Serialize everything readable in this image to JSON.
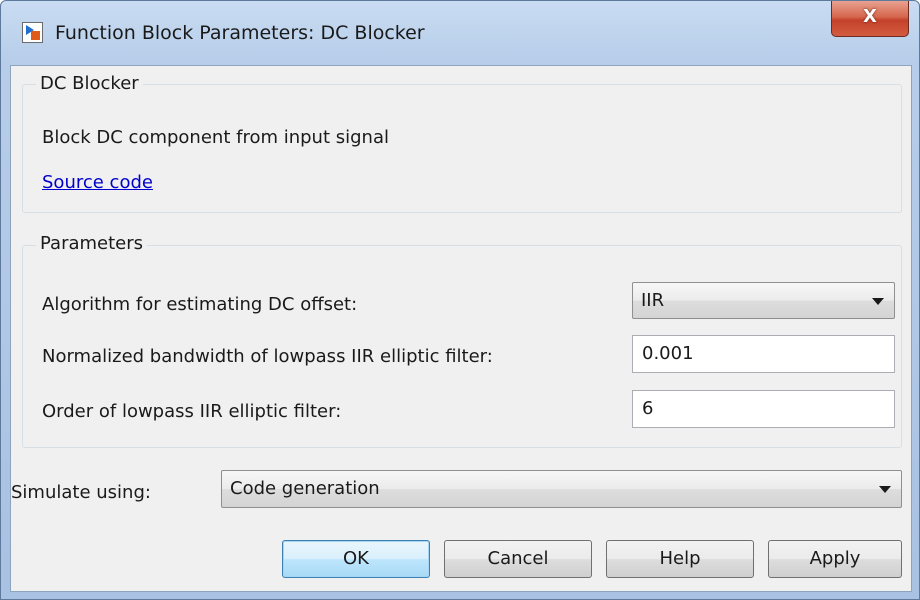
{
  "window": {
    "title": "Function Block Parameters: DC Blocker",
    "close_label": "X"
  },
  "block": {
    "group_label": "DC Blocker",
    "description": "Block DC component from input signal",
    "source_link": "Source code"
  },
  "parameters": {
    "group_label": "Parameters",
    "algorithm_label": "Algorithm for estimating DC offset:",
    "algorithm_value": "IIR",
    "bandwidth_label": "Normalized bandwidth of lowpass IIR elliptic filter:",
    "bandwidth_value": "0.001",
    "order_label": "Order of lowpass IIR elliptic filter:",
    "order_value": "6"
  },
  "simulate": {
    "label": "Simulate using:",
    "value": "Code generation"
  },
  "buttons": {
    "ok": "OK",
    "cancel": "Cancel",
    "help": "Help",
    "apply": "Apply"
  },
  "icons": {
    "title": "simulink-block-icon",
    "close": "close-icon",
    "dropdown": "chevron-down-icon"
  }
}
